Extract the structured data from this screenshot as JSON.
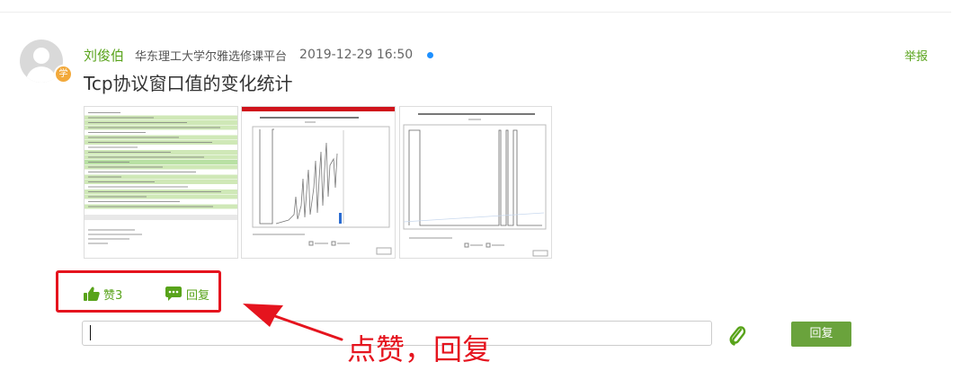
{
  "post": {
    "author": "刘俊伯",
    "role_badge": "学",
    "school": "华东理工大学尔雅选修课平台",
    "timestamp": "2019-12-29 16:50",
    "title": "Tcp协议窗口值的变化统计",
    "report_label": "举报"
  },
  "actions": {
    "like_label": "赞3",
    "reply_label": "回复"
  },
  "reply_box": {
    "value": "",
    "button_label": "回复"
  },
  "annotation": {
    "text": "点赞，回复"
  },
  "colors": {
    "accent_green": "#58a31a",
    "button_green": "#6aa33c",
    "annotation_red": "#e5141e",
    "online_dot": "#1e90ff"
  }
}
